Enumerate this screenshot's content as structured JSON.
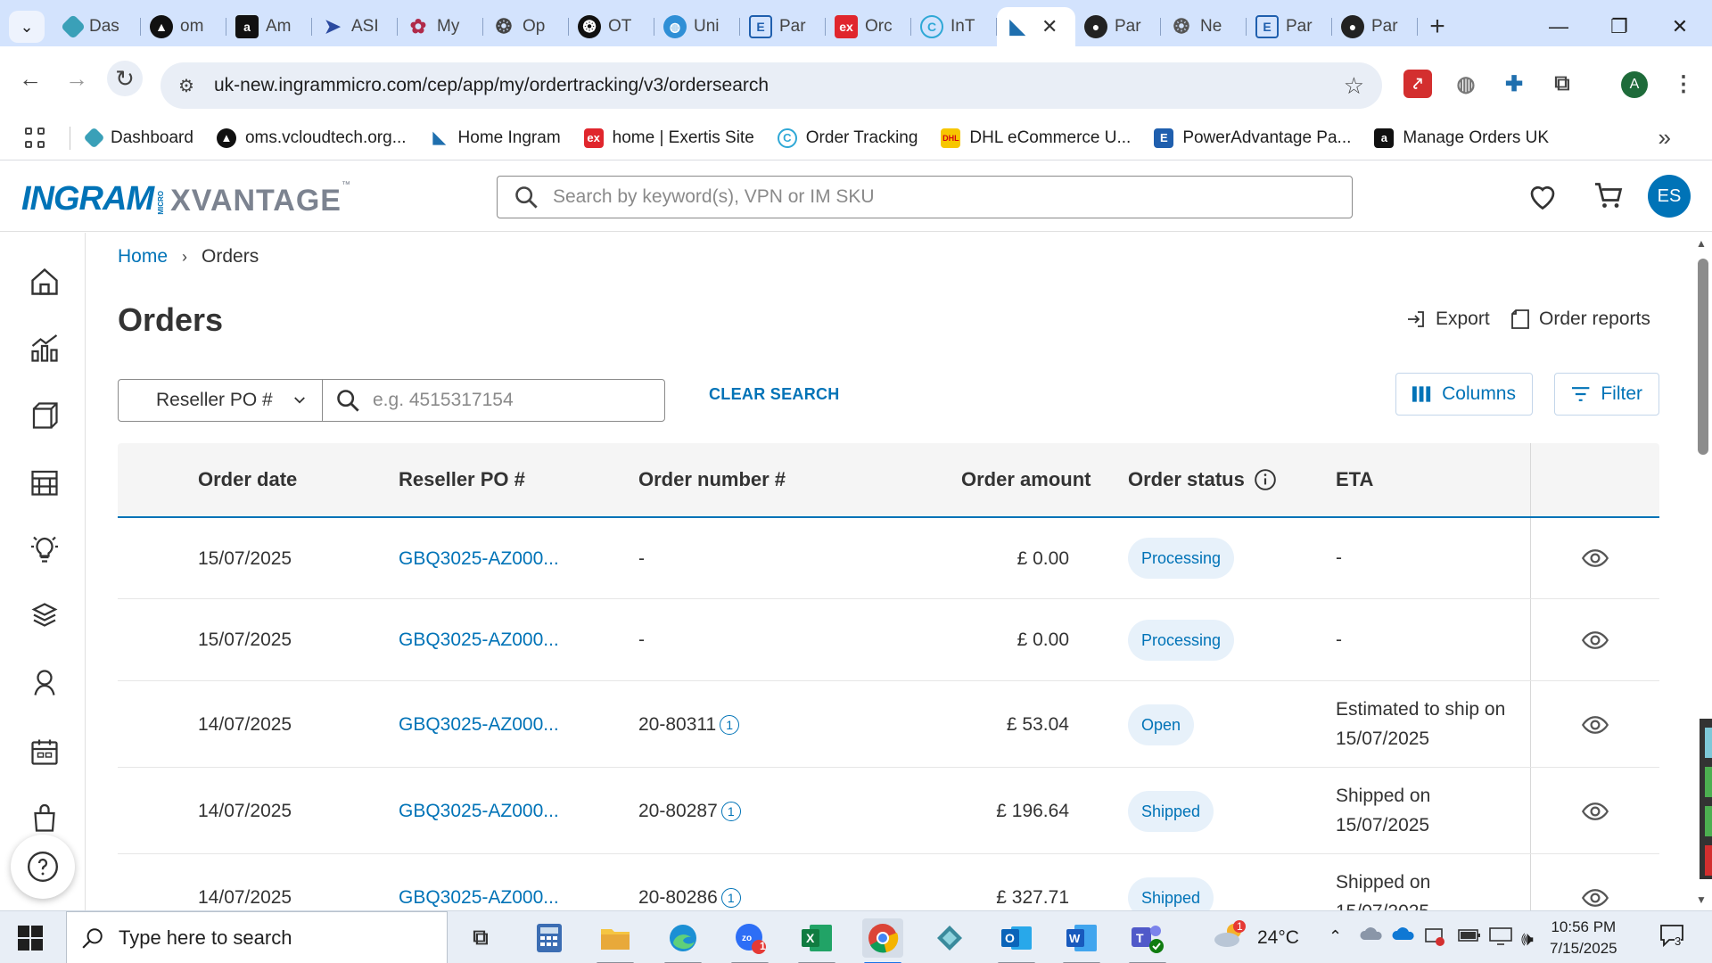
{
  "browser": {
    "tabs": [
      {
        "title": "Das",
        "icon": "hexagon-icon",
        "color": "#3aa0b8"
      },
      {
        "title": "om",
        "icon": "om-logo-icon",
        "color": "#111111"
      },
      {
        "title": "Am",
        "icon": "amazon-icon",
        "color": "#111111"
      },
      {
        "title": "ASI",
        "icon": "asi-arrow-icon",
        "color": "#2b4aa0"
      },
      {
        "title": "My",
        "icon": "flowers-icon",
        "color": "#b02a4a"
      },
      {
        "title": "Op",
        "icon": "openai-icon",
        "color": "#444444"
      },
      {
        "title": "OT",
        "icon": "openai-icon",
        "color": "#111111"
      },
      {
        "title": "Uni",
        "icon": "globe-icon",
        "color": "#2f8fd6"
      },
      {
        "title": "Par",
        "icon": "exertis-e-icon",
        "color": "#1f5fae"
      },
      {
        "title": "Orc",
        "icon": "exertis-ex-icon",
        "color": "#e0262d"
      },
      {
        "title": "InT",
        "icon": "c-logo-icon",
        "color": "#2fa8d6"
      },
      {
        "title": "",
        "icon": "ingram-icon",
        "color": "#1f6fae",
        "active": true,
        "close": "✕"
      },
      {
        "title": "Par",
        "icon": "powerpuff-icon",
        "color": "#222222"
      },
      {
        "title": "Ne",
        "icon": "openai-icon",
        "color": "#555555"
      },
      {
        "title": "Par",
        "icon": "exertis-e-icon",
        "color": "#1f5fae"
      },
      {
        "title": "Par",
        "icon": "powerpuff-icon",
        "color": "#222222"
      }
    ],
    "new_tab": "+",
    "url": "uk-new.ingrammicro.com/cep/app/my/ordertracking/v3/ordersearch",
    "profile_initial": "A",
    "bookmarks": [
      {
        "label": "Dashboard",
        "icon": "hexagon-icon",
        "color": "#3aa0b8"
      },
      {
        "label": "oms.vcloudtech.org...",
        "icon": "om-logo-icon",
        "color": "#111111"
      },
      {
        "label": "Home Ingram",
        "icon": "ingram-icon",
        "color": "#1f6fae"
      },
      {
        "label": "home | Exertis Site",
        "icon": "exertis-ex-icon",
        "color": "#e0262d"
      },
      {
        "label": "Order Tracking",
        "icon": "c-logo-icon",
        "color": "#2fa8d6"
      },
      {
        "label": "DHL eCommerce U...",
        "icon": "dhl-icon",
        "color": "#f7c600"
      },
      {
        "label": "PowerAdvantage Pa...",
        "icon": "exertis-e-icon",
        "color": "#1f5fae"
      },
      {
        "label": "Manage Orders UK",
        "icon": "amazon-icon",
        "color": "#111111"
      }
    ],
    "more_bookmarks": "»"
  },
  "header": {
    "logo_ingram": "INGRAM",
    "logo_micro": "MICRO",
    "logo_xvantage": "XVANTAGE",
    "logo_tm": "™",
    "search_placeholder": "Search by keyword(s), VPN or IM SKU",
    "avatar": "ES"
  },
  "breadcrumb": {
    "home": "Home",
    "separator": "›",
    "current": "Orders"
  },
  "page": {
    "title": "Orders",
    "export_label": "Export",
    "reports_label": "Order reports",
    "filter_select": "Reseller PO #",
    "filter_placeholder": "e.g. 4515317154",
    "clear_search": "CLEAR SEARCH",
    "columns_label": "Columns",
    "filter_label": "Filter"
  },
  "table": {
    "headers": [
      "Order date",
      "Reseller PO #",
      "Order number #",
      "Order amount",
      "Order status",
      "ETA"
    ],
    "rows": [
      {
        "date": "15/07/2025",
        "po": "GBQ3025-AZ000...",
        "order": "-",
        "order_info": false,
        "amount": "£ 0.00",
        "status": "Processing",
        "eta1": "-",
        "eta2": ""
      },
      {
        "date": "15/07/2025",
        "po": "GBQ3025-AZ000...",
        "order": "-",
        "order_info": false,
        "amount": "£ 0.00",
        "status": "Processing",
        "eta1": "-",
        "eta2": ""
      },
      {
        "date": "14/07/2025",
        "po": "GBQ3025-AZ000...",
        "order": "20-80311",
        "order_info": true,
        "amount": "£ 53.04",
        "status": "Open",
        "eta1": "Estimated to ship on",
        "eta2": "15/07/2025"
      },
      {
        "date": "14/07/2025",
        "po": "GBQ3025-AZ000...",
        "order": "20-80287",
        "order_info": true,
        "amount": "£ 196.64",
        "status": "Shipped",
        "eta1": "Shipped on",
        "eta2": "15/07/2025"
      },
      {
        "date": "14/07/2025",
        "po": "GBQ3025-AZ000...",
        "order": "20-80286",
        "order_info": true,
        "amount": "£ 327.71",
        "status": "Shipped",
        "eta1": "Shipped on",
        "eta2": "15/07/2025"
      }
    ]
  },
  "taskbar": {
    "search_placeholder": "Type here to search",
    "temperature": "24°C",
    "time": "10:56 PM",
    "date": "7/15/2025",
    "notification_count": "3",
    "weather_badge": "1",
    "zoom_badge": "1"
  },
  "colors": {
    "brand": "#0073b7",
    "badge_bg": "#e7f1fa",
    "tabbar": "#d3e3fd"
  }
}
